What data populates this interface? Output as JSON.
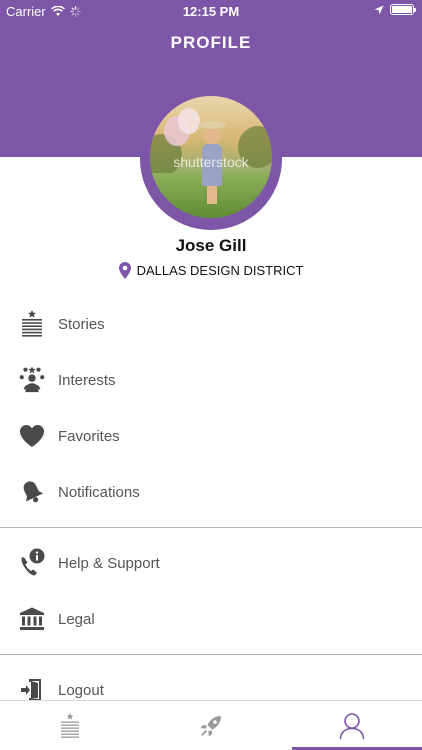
{
  "status_bar": {
    "carrier": "Carrier",
    "time": "12:15 PM"
  },
  "header": {
    "title": "PROFILE"
  },
  "profile": {
    "watermark": "shutterstock",
    "name": "Jose Gill",
    "location": "DALLAS DESIGN DISTRICT"
  },
  "menu": {
    "items": [
      {
        "label": "Stories",
        "icon": "stories-icon"
      },
      {
        "label": "Interests",
        "icon": "interests-icon"
      },
      {
        "label": "Favorites",
        "icon": "heart-icon"
      },
      {
        "label": "Notifications",
        "icon": "bell-icon"
      }
    ],
    "support_items": [
      {
        "label": "Help & Support",
        "icon": "phone-info-icon"
      },
      {
        "label": "Legal",
        "icon": "courthouse-icon"
      }
    ],
    "logout_label": "Logout"
  },
  "tabbar": {
    "tabs": [
      {
        "icon": "stories-icon",
        "active": false
      },
      {
        "icon": "rocket-icon",
        "active": false
      },
      {
        "icon": "profile-icon",
        "active": true
      }
    ]
  },
  "colors": {
    "brand": "#7e56a8",
    "icon": "#4a4a4a",
    "text": "#555555"
  }
}
